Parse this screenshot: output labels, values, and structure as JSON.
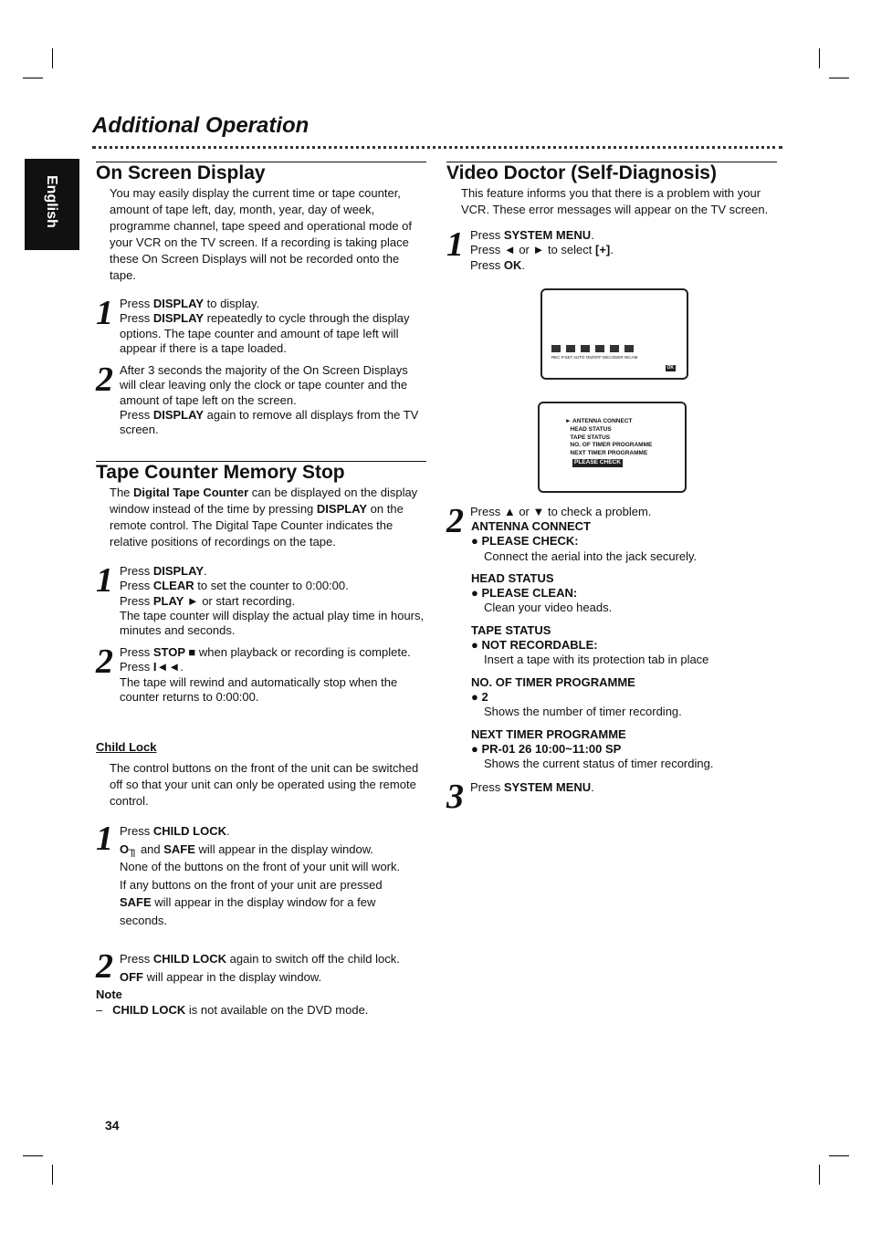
{
  "header": {
    "title": "Additional Operation",
    "language_tab": "English"
  },
  "page_number": "34",
  "osd": {
    "heading": "On Screen Display",
    "intro": "You may easily display the current time or tape counter, amount of tape left, day, month, year, day of week, programme channel, tape speed and operational mode of your VCR on the TV screen. If a recording is taking place these On Screen Displays will not be recorded onto the tape.",
    "step1": {
      "num": "1",
      "l1a": "Press ",
      "l1b": "DISPLAY",
      "l1c": " to display.",
      "l2a": "Press ",
      "l2b": "DISPLAY",
      "l2c": " repeatedly to cycle through the display options. The tape counter and amount of tape left will appear if there is a tape loaded."
    },
    "step2": {
      "num": "2",
      "l1": "After 3 seconds the majority of the On Screen Displays will clear leaving only the clock or tape counter and the amount of tape left on the screen.",
      "l2a": "Press ",
      "l2b": "DISPLAY",
      "l2c": " again to remove all displays from the TV screen."
    }
  },
  "tcms": {
    "heading": "Tape Counter Memory Stop",
    "intro_a": "The ",
    "intro_b": "Digital Tape Counter",
    "intro_c": " can be displayed on the display window instead of the time by pressing ",
    "intro_d": "DISPLAY",
    "intro_e": " on the remote control. The Digital Tape Counter indicates the relative positions of recordings on the tape.",
    "step1": {
      "num": "1",
      "a1": "Press ",
      "b1": "DISPLAY",
      "c1": ".",
      "a2": "Press ",
      "b2": "CLEAR",
      "c2": " to set the counter to 0:00:00.",
      "a3": "Press ",
      "b3": "PLAY ►",
      "c3": " or start recording.",
      "l4": "The tape counter will display the actual play time in hours, minutes and seconds."
    },
    "step2": {
      "num": "2",
      "a1": "Press ",
      "b1": "STOP ■",
      "c1": " when playback or recording is complete.",
      "a2": "Press ",
      "b2": "I◄◄",
      "c2": ".",
      "l3": "The tape will rewind and automatically stop when the counter returns to 0:00:00."
    }
  },
  "child_lock": {
    "heading": "Child Lock",
    "intro": "The control buttons on the front of the unit can be switched off so that your unit can only be operated using the remote control.",
    "step1": {
      "num": "1",
      "a1": "Press ",
      "b1": "CHILD LOCK",
      "c1": ".",
      "key": "O╖",
      "a2": " and ",
      "b2": "SAFE",
      "c2": " will appear in the display window.",
      "l3": "None of the  buttons on the front of your unit will work.",
      "l4": "If any buttons on the front of your unit are pressed",
      "b5": "SAFE",
      "c5": " will appear in the display window for a few seconds."
    },
    "step2": {
      "num": "2",
      "a1": "Press ",
      "b1": "CHILD LOCK",
      "c1": " again to switch off the child lock.",
      "b2": "OFF",
      "c2": " will appear in the display window."
    },
    "note_label": "Note",
    "note_dash": "–",
    "note_b": "CHILD LOCK",
    "note_c": " is not available on the DVD mode."
  },
  "vd": {
    "heading": "Video Doctor (Self-Diagnosis)",
    "intro": "This feature informs you that there is a problem with your VCR. These error messages will appear on the TV screen.",
    "step1": {
      "num": "1",
      "a1": "Press ",
      "b1": "SYSTEM MENU",
      "c1": ".",
      "a2": "Press ◄ or ► to select ",
      "icon": "[+]",
      "c2": ".",
      "a3": "Press ",
      "b3": "OK",
      "c3": "."
    },
    "screen1": {
      "labels": [
        "REC",
        "P.SET",
        "AUTO",
        "ON/OFF",
        "DECODER",
        "NICAM",
        "OK"
      ]
    },
    "screen2": {
      "items": [
        "ANTENNA CONNECT",
        "HEAD STATUS",
        "TAPE STATUS",
        "NO. OF TIMER PROGRAMME",
        "NEXT TIMER PROGRAMME"
      ],
      "badge": "PLEASE CHECK"
    },
    "step2": {
      "num": "2",
      "intro": "Press ▲ or ▼ to check a problem.",
      "items": [
        {
          "h": "ANTENNA CONNECT",
          "v": "● PLEASE CHECK:",
          "d": "Connect the aerial into the jack securely."
        },
        {
          "h": "HEAD STATUS",
          "v": "● PLEASE CLEAN:",
          "d": "Clean your video heads."
        },
        {
          "h": "TAPE STATUS",
          "v": "● NOT RECORDABLE:",
          "d": "Insert a tape with its protection tab in place"
        },
        {
          "h": "NO. OF TIMER PROGRAMME",
          "v": "● 2",
          "d": "Shows the number of timer recording."
        },
        {
          "h": "NEXT TIMER PROGRAMME",
          "v": "● PR-01 26 10:00~11:00 SP",
          "d": "Shows the current status of timer recording."
        }
      ]
    },
    "step3": {
      "num": "3",
      "a": "Press ",
      "b": "SYSTEM MENU",
      "c": "."
    }
  }
}
